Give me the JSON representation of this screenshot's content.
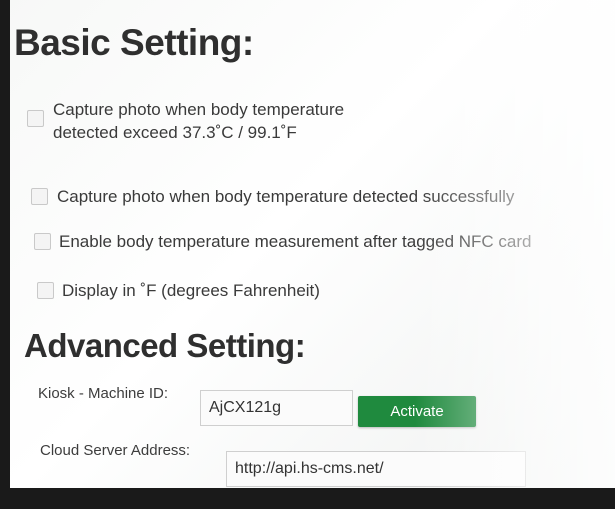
{
  "basic_setting": {
    "title": "Basic Setting:",
    "options": [
      {
        "line1": "Capture photo when body temperature",
        "line2": "detected exceed 37.3˚C / 99.1˚F",
        "checked": false
      },
      {
        "line1": "Capture photo when body temperature detected successfully",
        "checked": false
      },
      {
        "line1": "Enable body temperature measurement after tagged NFC card",
        "checked": false
      },
      {
        "line1": "Display in ˚F (degrees Fahrenheit)",
        "checked": false
      }
    ]
  },
  "advanced_setting": {
    "title": "Advanced Setting:",
    "machine_id_label": "Kiosk - Machine ID:",
    "machine_id_value": "AjCX121g",
    "activate_label": "Activate",
    "server_label": "Cloud Server Address:",
    "server_value": "http://api.hs-cms.net/"
  },
  "colors": {
    "accent_button": "#1f8a3e",
    "heading_text": "#2f2f2f"
  }
}
